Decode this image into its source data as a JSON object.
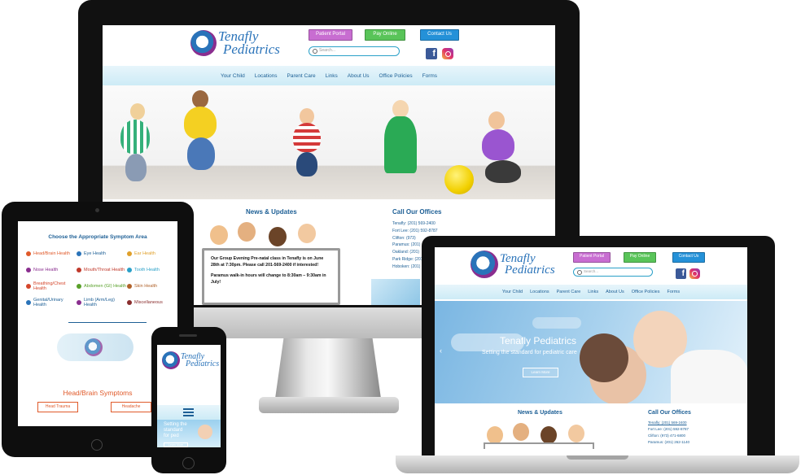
{
  "site": {
    "logo_line1": "Tenafly",
    "logo_line2": "Pediatrics",
    "logo_small1": "Tenafly",
    "logo_small2": "Pediatrics",
    "buttons": {
      "portal": "Patient Portal",
      "pay": "Pay Online",
      "contact": "Contact Us"
    },
    "search_placeholder": "Search...",
    "social": {
      "facebook": "facebook-icon",
      "instagram": "instagram-icon"
    }
  },
  "nav": {
    "your_child": "Your Child",
    "locations": "Locations",
    "parent_care": "Parent Care",
    "links": "Links",
    "about_us": "About Us",
    "office_policies": "Office Policies",
    "forms": "Forms"
  },
  "news": {
    "title": "News & Updates",
    "notice1": "Our Group Evening Pre-natal class in Tenafly is on June 28th at 7:30pm.  Please call 201-569-2400 if interested!",
    "notice2": "Paramus walk-in hours will change to 8:30am – 9:30am in July!"
  },
  "offices": {
    "title": "Call Our Offices",
    "desktop": [
      "Tenafly: (201) 569-2400",
      "Fort Lee: (201) 592-8787",
      "Clifton: (973)",
      "Paramus: (201)",
      "Oakland: (201)",
      "Park Ridge: (201)",
      "Hoboken: (201)"
    ],
    "laptop": [
      "Tenafly: (201) 569-2400",
      "Fort Lee: (201) 592-8787",
      "Clifton: (973) 471-6800",
      "Paramus: (201) 262-1140"
    ]
  },
  "hero": {
    "title": "Tenafly Pediatrics",
    "subtitle": "Setting the standard for pediatric care",
    "button": "Learn More"
  },
  "tablet": {
    "heading": "Choose the Appropriate Symptom Area",
    "symptoms": [
      {
        "label": "Head/Brain Health",
        "color": "#e05a2a"
      },
      {
        "label": "Eye Health",
        "color": "#2a73b9"
      },
      {
        "label": "Ear Health",
        "color": "#e0a02a"
      },
      {
        "label": "Nose Health",
        "color": "#8a2e8f"
      },
      {
        "label": "Mouth/Throat Health",
        "color": "#c0392b"
      },
      {
        "label": "Tooth Health",
        "color": "#2aa0c8"
      },
      {
        "label": "Breathing/Chest Health",
        "color": "#d4462b"
      },
      {
        "label": "Abdomen (GI) Health",
        "color": "#59a02a"
      },
      {
        "label": "Skin Health",
        "color": "#b0622a"
      },
      {
        "label": "Genital/Urinary Health",
        "color": "#2a73b9"
      },
      {
        "label": "Limb (Arm/Leg) Health",
        "color": "#8a2e8f"
      },
      {
        "label": "Miscellaneous",
        "color": "#8a2e2e"
      }
    ],
    "section_title": "Head/Brain Symptoms",
    "tag1": "Head Trauma",
    "tag2": "Headache"
  },
  "phone": {
    "hero_text_1": "Setting the",
    "hero_text_2": "standard",
    "hero_text_3": "for ped",
    "button": "Learn More"
  }
}
